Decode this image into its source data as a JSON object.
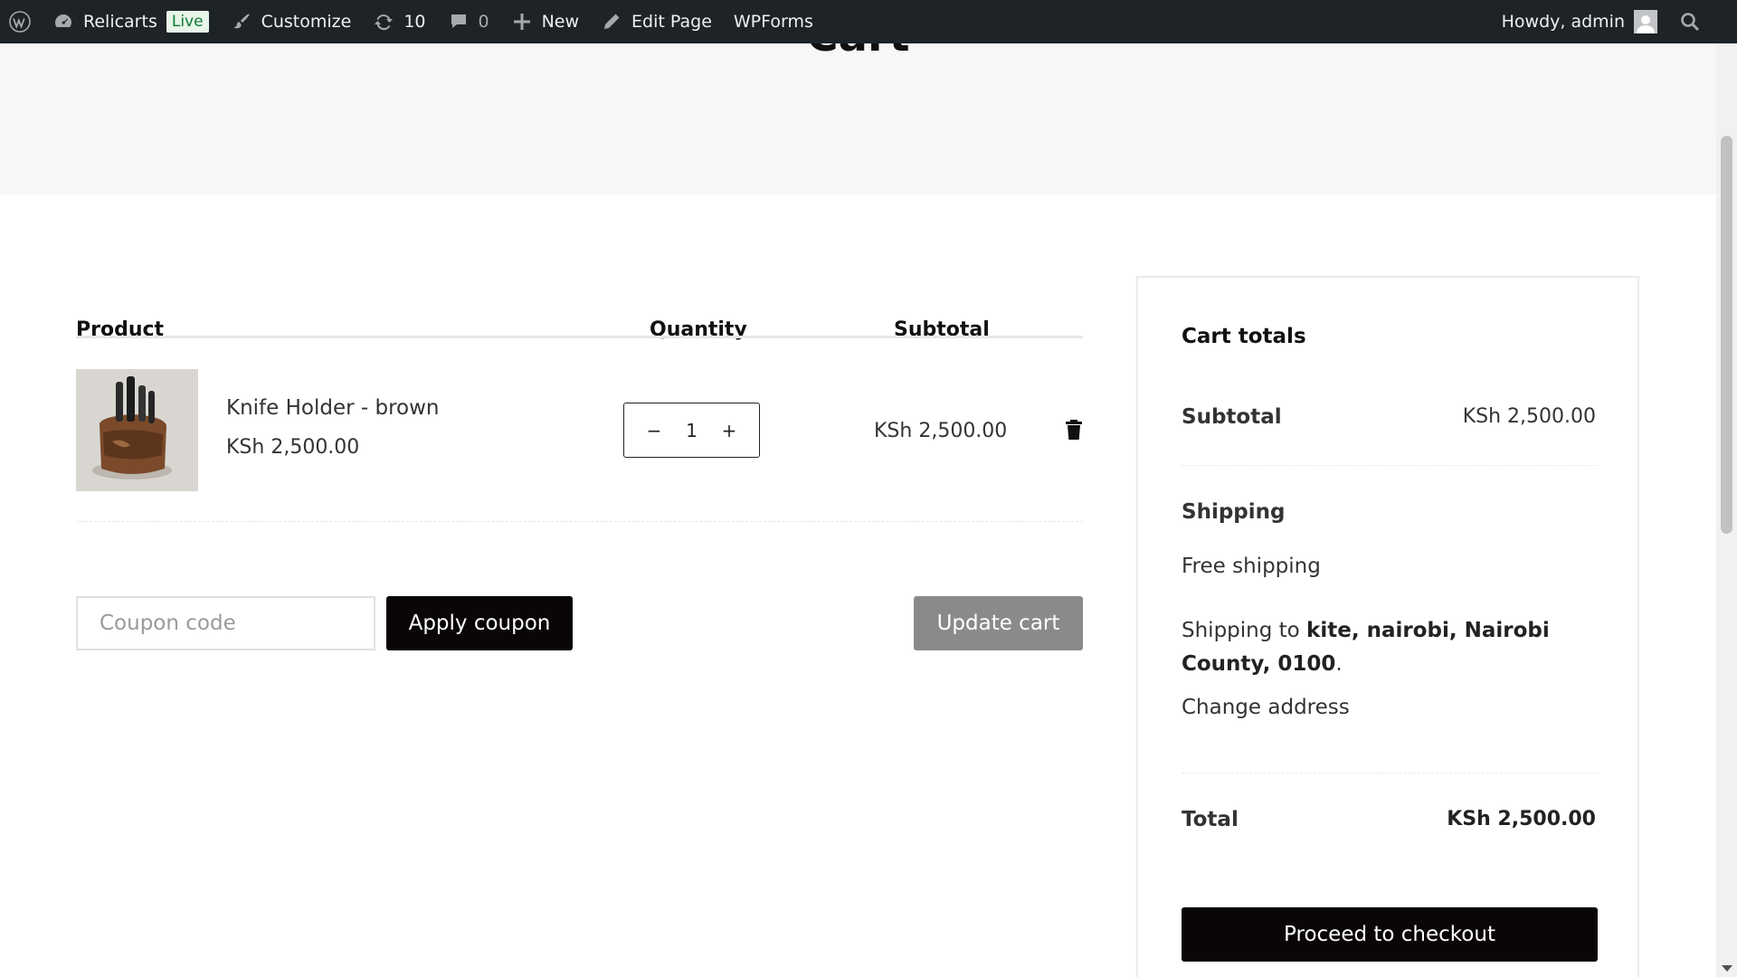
{
  "adminbar": {
    "site_name": "Relicarts",
    "live_badge": "Live",
    "customize": "Customize",
    "updates_count": "10",
    "comments_count": "0",
    "new": "New",
    "edit_page": "Edit Page",
    "wpforms": "WPForms",
    "howdy": "Howdy, admin"
  },
  "page": {
    "title": "Cart"
  },
  "cart": {
    "headers": {
      "product": "Product",
      "quantity": "Quantity",
      "subtotal": "Subtotal"
    },
    "items": [
      {
        "name": "Knife Holder - brown",
        "price": "KSh 2,500.00",
        "quantity": "1",
        "subtotal": "KSh 2,500.00"
      }
    ],
    "qty_minus": "−",
    "qty_plus": "+",
    "coupon_placeholder": "Coupon code",
    "apply_coupon": "Apply coupon",
    "update_cart": "Update cart"
  },
  "totals": {
    "title": "Cart totals",
    "subtotal_label": "Subtotal",
    "subtotal_value": "KSh 2,500.00",
    "shipping_label": "Shipping",
    "shipping_method": "Free shipping",
    "shipping_to_prefix": "Shipping to",
    "shipping_to_address": "kite, nairobi, Nairobi County, 0100",
    "shipping_to_suffix": ".",
    "change_address": "Change address",
    "total_label": "Total",
    "total_value": "KSh 2,500.00",
    "checkout": "Proceed to checkout"
  },
  "colors": {
    "adminbar_bg": "#1d2327",
    "primary_button": "#0a0606",
    "disabled_button": "#8a8a8a",
    "hero_bg": "#f7f7f8"
  }
}
